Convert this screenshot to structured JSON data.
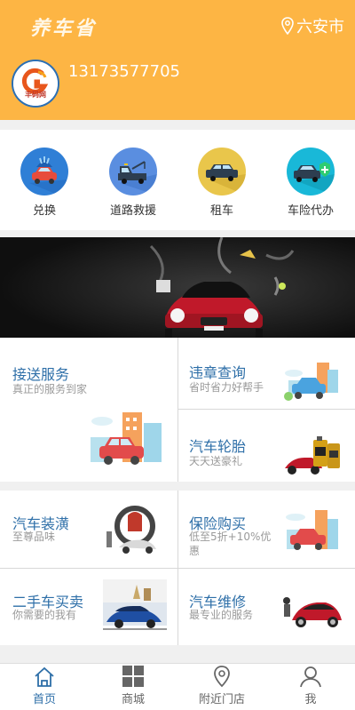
{
  "header": {
    "brand": "养车省",
    "city": "六安市",
    "phone": "13173577705",
    "avatar_text": "丰码网",
    "accent_color": "#fdb544"
  },
  "quick_menu": [
    {
      "label": "兑换",
      "icon": "car-wash-icon",
      "color": "#2f7fd6"
    },
    {
      "label": "道路救援",
      "icon": "tow-truck-icon",
      "color": "#5a8ee0"
    },
    {
      "label": "租车",
      "icon": "rental-car-icon",
      "color": "#e9c64b"
    },
    {
      "label": "车险代办",
      "icon": "insurance-car-icon",
      "color": "#19b8d8"
    }
  ],
  "services": {
    "pickup": {
      "title": "接送服务",
      "subtitle": "真正的服务到家"
    },
    "violation": {
      "title": "违章查询",
      "subtitle": "省时省力好帮手"
    },
    "tire": {
      "title": "汽车轮胎",
      "subtitle": "天天送豪礼"
    },
    "decoration": {
      "title": "汽车装潢",
      "subtitle": "至尊品味"
    },
    "insurance": {
      "title": "保险购买",
      "subtitle": "低至5折+10%优惠"
    },
    "used_car": {
      "title": "二手车买卖",
      "subtitle": "你需要的我有"
    },
    "repair": {
      "title": "汽车维修",
      "subtitle": "最专业的服务"
    }
  },
  "tabbar": [
    {
      "label": "首页",
      "icon": "home-icon",
      "active": true
    },
    {
      "label": "商城",
      "icon": "grid-icon",
      "active": false
    },
    {
      "label": "附近门店",
      "icon": "location-icon",
      "active": false
    },
    {
      "label": "我",
      "icon": "user-icon",
      "active": false
    }
  ]
}
